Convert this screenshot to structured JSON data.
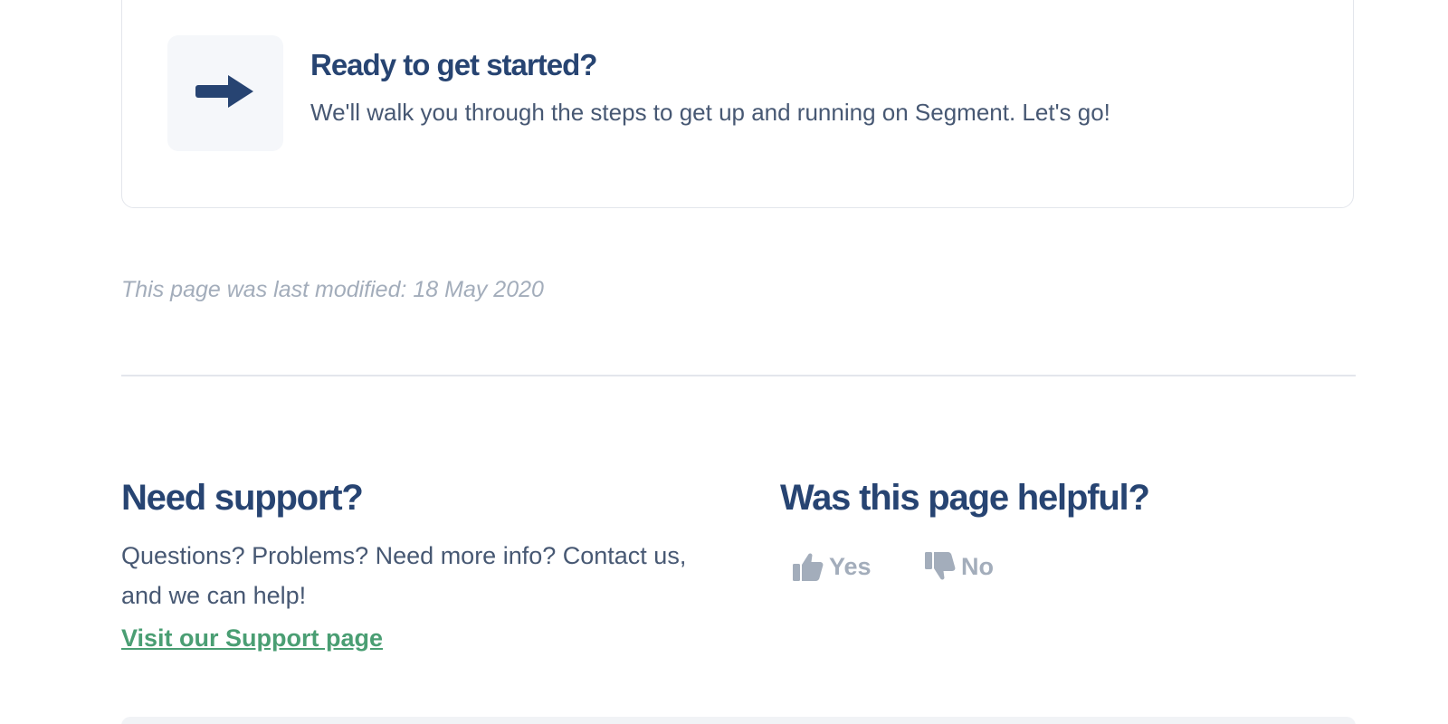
{
  "cta": {
    "title": "Ready to get started?",
    "description": "We'll walk you through the steps to get up and running on Segment. Let's go!",
    "icon": "arrow-right-icon"
  },
  "last_modified": "This page was last modified: 18 May 2020",
  "support": {
    "title": "Need support?",
    "description": "Questions? Problems? Need more info? Contact us, and we can help!",
    "link_label": "Visit our Support page"
  },
  "helpful": {
    "title": "Was this page helpful?",
    "yes_label": "Yes",
    "no_label": "No",
    "yes_icon": "thumbs-up-icon",
    "no_icon": "thumbs-down-icon"
  },
  "colors": {
    "heading": "#274472",
    "body_text": "#475873",
    "muted": "#a3adbb",
    "link": "#4a9e73",
    "border": "#e3e6ec"
  }
}
